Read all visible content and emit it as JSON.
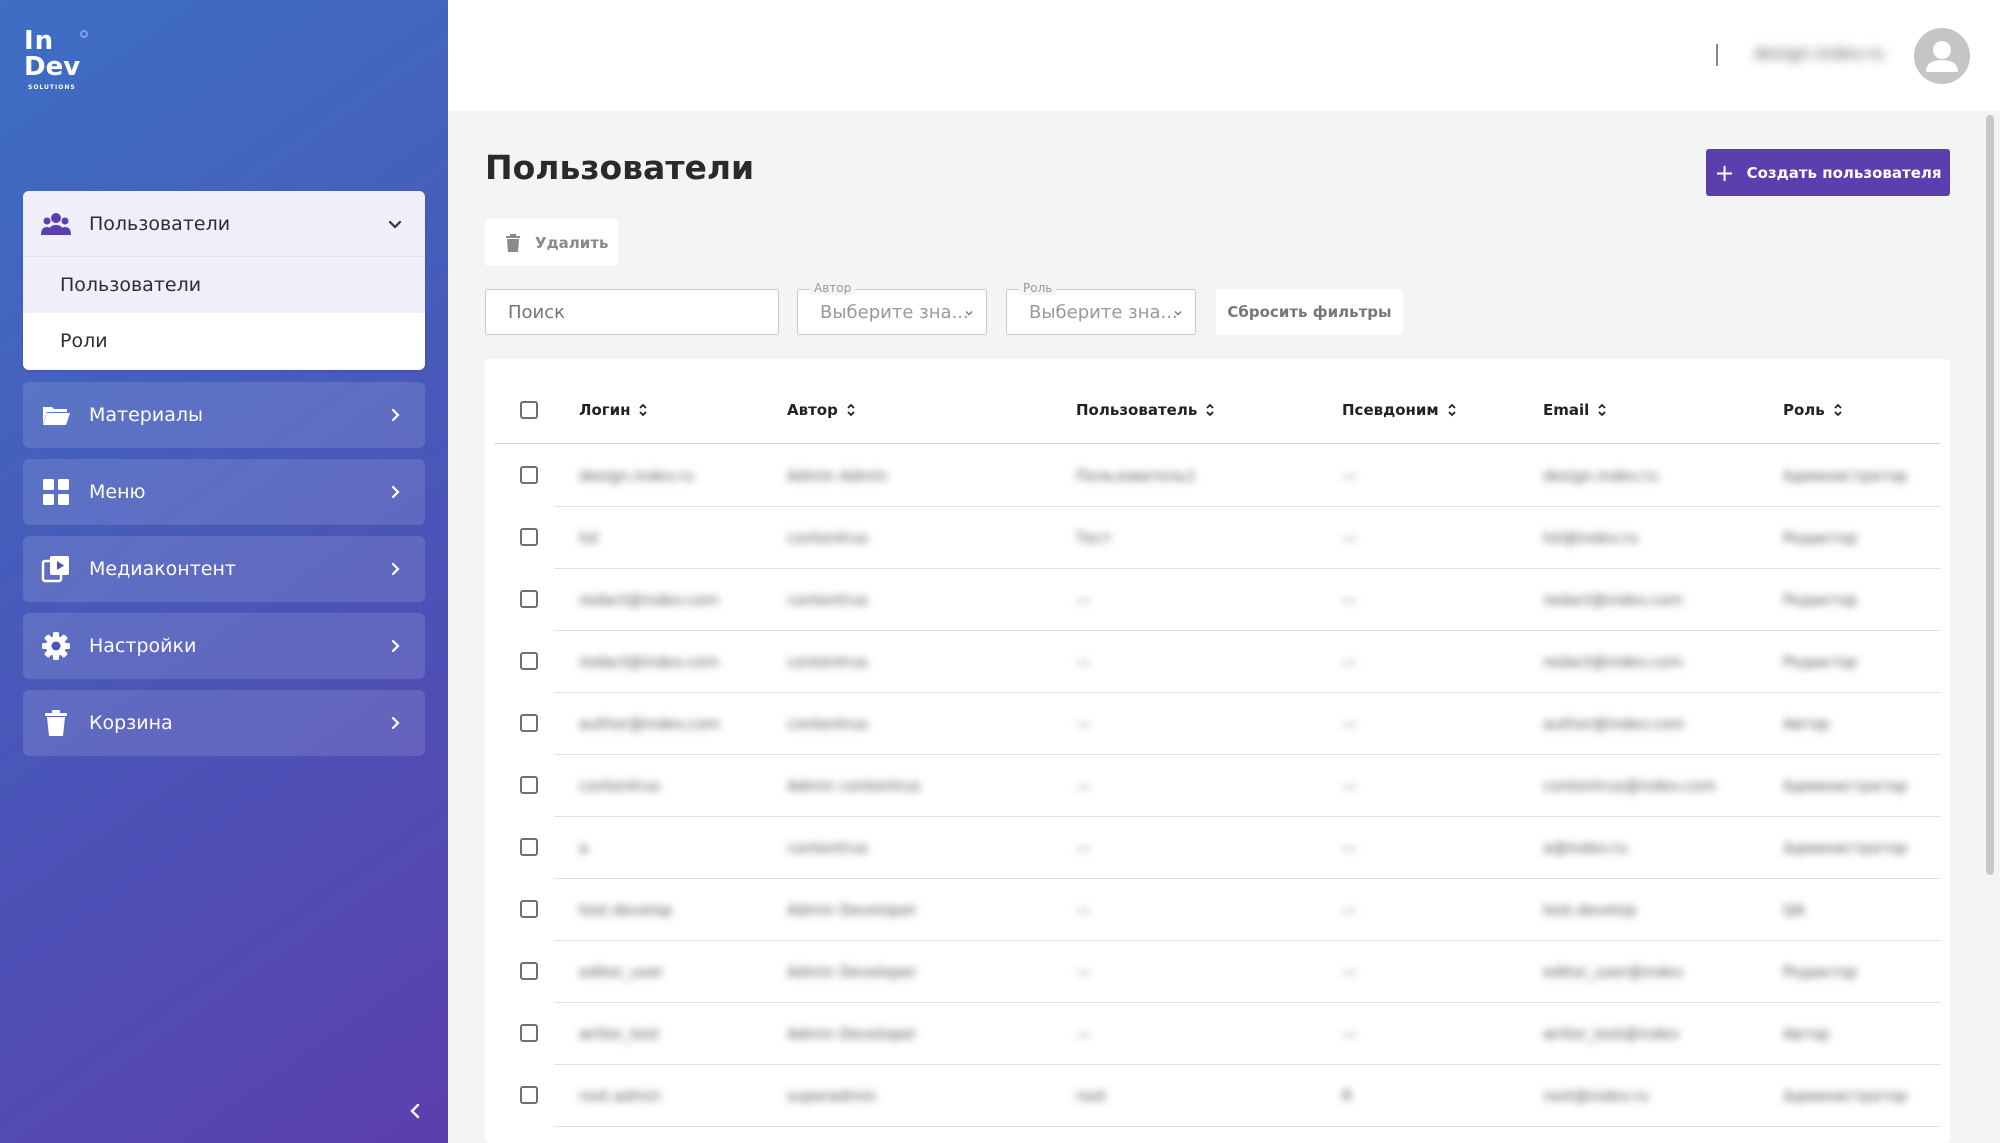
{
  "app": {
    "logo_line1": "In",
    "logo_line2": "Dev",
    "logo_line3": "SOLUTIONS",
    "accent_color": "#5b3fae"
  },
  "sidebar": {
    "open_group": {
      "label": "Пользователи",
      "icon": "users-icon",
      "subitems": [
        {
          "label": "Пользователи",
          "active": true
        },
        {
          "label": "Роли",
          "active": false
        }
      ]
    },
    "items": [
      {
        "label": "Материалы",
        "icon": "folder-icon"
      },
      {
        "label": "Меню",
        "icon": "grid-icon"
      },
      {
        "label": "Медиаконтент",
        "icon": "media-icon"
      },
      {
        "label": "Настройки",
        "icon": "gear-icon"
      },
      {
        "label": "Корзина",
        "icon": "trash-icon"
      }
    ]
  },
  "topbar": {
    "username": "design.indev.ru"
  },
  "main": {
    "title": "Пользователи",
    "create_button": "Создать пользователя",
    "delete_button": "Удалить",
    "search_placeholder": "Поиск",
    "filters": [
      {
        "legend": "Автор",
        "value": "Выберите зна..."
      },
      {
        "legend": "Роль",
        "value": "Выберите зна..."
      }
    ],
    "reset_button": "Сбросить фильтры"
  },
  "table": {
    "columns": [
      "Логин",
      "Автор",
      "Пользователь",
      "Псевдоним",
      "Email",
      "Роль"
    ],
    "rows": [
      [
        "design.indev.ru",
        "Admin Admin",
        "Пользователь1",
        "—",
        "design.indev.ru",
        "Администратор"
      ],
      [
        "tst",
        "contentrus",
        "Тест",
        "—",
        "tst@indev.ru",
        "Редактор"
      ],
      [
        "redact@indev.com",
        "contentrus",
        "—",
        "—",
        "redact@indev.com",
        "Редактор"
      ],
      [
        "redact@indev.com",
        "contentrus",
        "—",
        "—",
        "redact@indev.com",
        "Редактор"
      ],
      [
        "author@indev.com",
        "contentrus",
        "—",
        "—",
        "author@indev.com",
        "Автор"
      ],
      [
        "contentrus",
        "Admin contentrus",
        "—",
        "—",
        "contentrus@indev.com",
        "Администратор"
      ],
      [
        "a",
        "contentrus",
        "—",
        "—",
        "a@indev.ru",
        "Администратор"
      ],
      [
        "test.develop",
        "Admin Developer",
        "—",
        "—",
        "test.develop",
        "QA"
      ],
      [
        "editor_user",
        "Admin Developer",
        "—",
        "—",
        "editor_user@indev",
        "Редактор"
      ],
      [
        "writer_test",
        "Admin Developer",
        "—",
        "—",
        "writer_test@indev",
        "Автор"
      ],
      [
        "root.admin",
        "superadmin",
        "root",
        "R",
        "root@indev.ru",
        "Администратор"
      ]
    ]
  }
}
